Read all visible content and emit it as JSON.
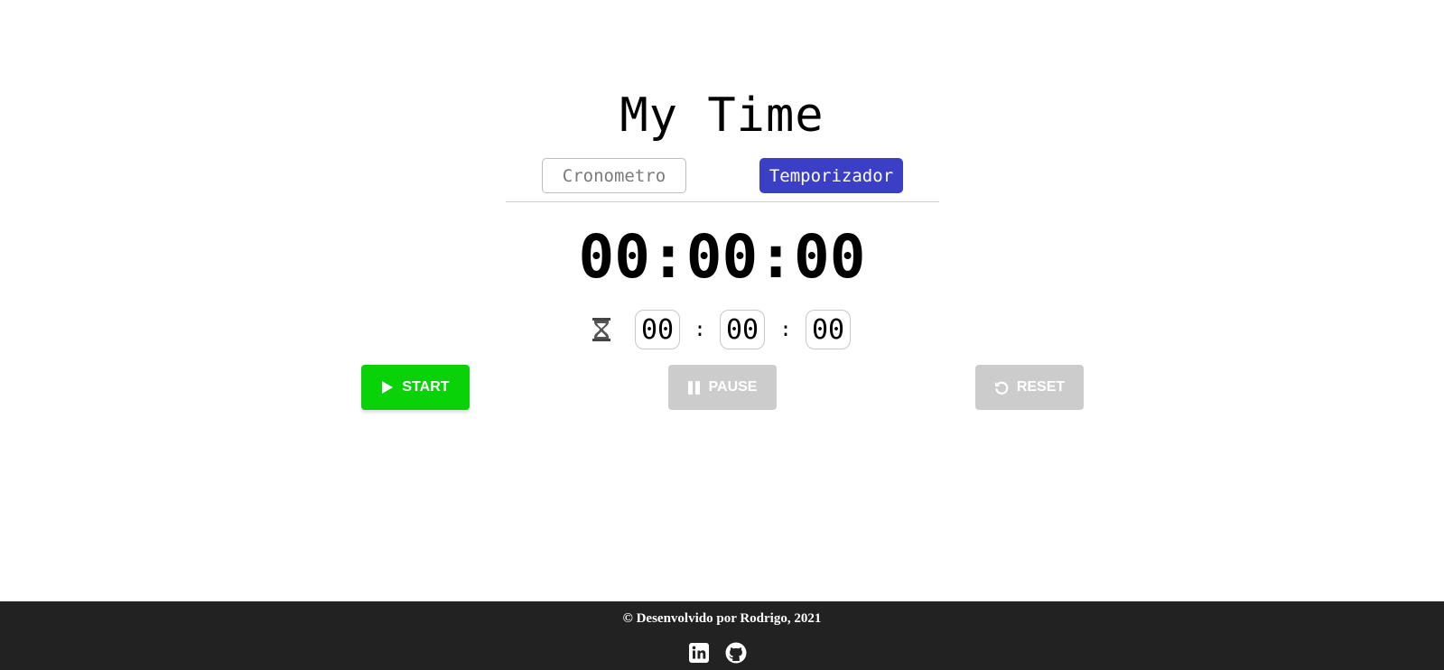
{
  "app": {
    "title": "My Time"
  },
  "tabs": [
    {
      "label": "Cronometro",
      "active": false
    },
    {
      "label": "Temporizador",
      "active": true
    }
  ],
  "clock": {
    "display": "00:00:00"
  },
  "timer_inputs": {
    "hours": "00",
    "minutes": "00",
    "seconds": "00",
    "separator": ":",
    "icon": "hourglass-icon"
  },
  "buttons": {
    "start_label": "START",
    "pause_label": "PAUSE",
    "reset_label": "RESET",
    "start_color": "#09d209",
    "disabled_color": "#cccccc"
  },
  "footer": {
    "text": "© Desenvolvido por Rodrigo, 2021",
    "icons": [
      "linkedin-icon",
      "github-icon"
    ]
  },
  "colors": {
    "accent": "#3a3fc6",
    "footer_bg": "#222222"
  }
}
